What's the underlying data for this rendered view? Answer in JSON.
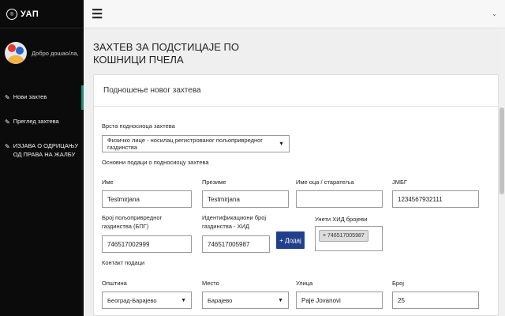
{
  "sidebar": {
    "brand": "УАП",
    "greeting": "Добро дошао/ла,",
    "items": [
      {
        "label": "Нови захтев"
      },
      {
        "label": "Преглед захтева"
      },
      {
        "label": "ИЗЈАВА О ОДРИЦАЊУ ОД ПРАВА НА ЖАЛБУ"
      }
    ]
  },
  "page_title": "ЗАХТЕВ ЗА ПОДСТИЦАЈЕ ПО КОШНИЦИ ПЧЕЛА",
  "form": {
    "card_title": "Подношење новог захтева",
    "submitter_type": {
      "label": "Врста подносиоца захтева",
      "value": "Физичко лице - носилац регистрованог пољопривредног газдинства"
    },
    "section_basic": "Основни подаци о подносиоцу захтева",
    "name": {
      "label": "Име",
      "value": "Testmirjana"
    },
    "surname": {
      "label": "Презиме",
      "value": "Testmirjana"
    },
    "parent": {
      "label": "Име оца / старатеља",
      "value": ""
    },
    "jmbg": {
      "label": "ЈМБГ",
      "value": "1234567932111"
    },
    "bpg": {
      "label": "Број пољопривредног газдинства (БПГ)",
      "value": "746517002999"
    },
    "hid": {
      "label": "Идентификациони број газдинства - ХИД",
      "value": "746517005987"
    },
    "add_button": "+ Додај",
    "hid_entered": {
      "label": "Унети ХИД бројеви",
      "tag": "× 746517005987"
    },
    "section_contact": "Контакт подаци",
    "municipality": {
      "label": "Општина",
      "value": "Београд-Барајево"
    },
    "place": {
      "label": "Место",
      "value": "Барајево"
    },
    "street": {
      "label": "Улица",
      "value": "Pajе Jovanovi"
    },
    "number": {
      "label": "Број",
      "value": "25"
    }
  }
}
